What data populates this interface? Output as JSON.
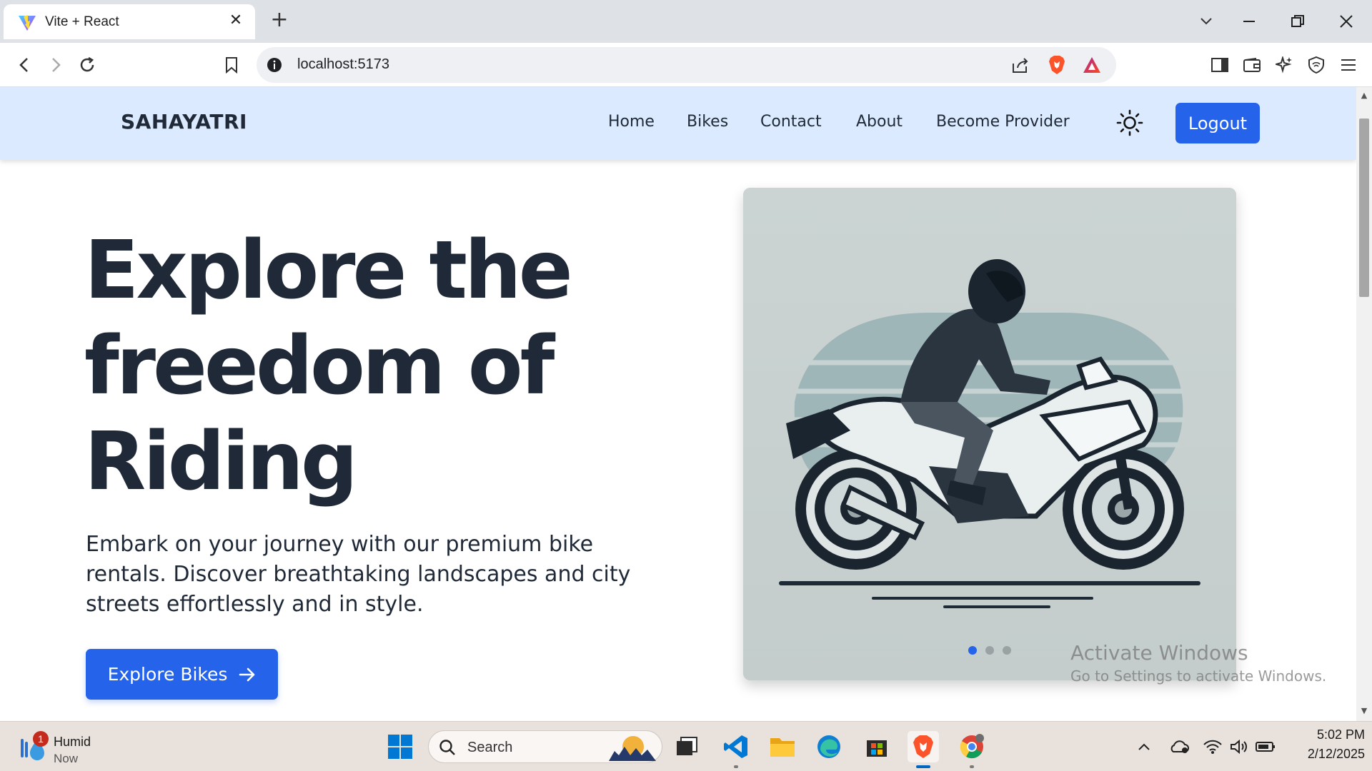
{
  "browser": {
    "tab_title": "Vite + React",
    "url": "localhost:5173"
  },
  "navbar": {
    "brand": "SAHAYATRI",
    "links": [
      "Home",
      "Bikes",
      "Contact",
      "About",
      "Become Provider"
    ],
    "logout_label": "Logout"
  },
  "hero": {
    "title_line1": "Explore the",
    "title_line2": "freedom of",
    "title_line3": "Riding",
    "description": "Embark on your journey with our premium bike rentals. Discover breathtaking landscapes and city streets effortlessly and in style.",
    "cta_label": "Explore Bikes"
  },
  "carousel": {
    "slide_count": 3,
    "active_slide": 1
  },
  "watermark": {
    "line1": "Activate Windows",
    "line2": "Go to Settings to activate Windows."
  },
  "taskbar": {
    "weather_title": "Humid",
    "weather_sub": "Now",
    "weather_badge": "1",
    "search_placeholder": "Search",
    "time": "5:02 PM",
    "date": "2/12/2025"
  },
  "colors": {
    "accent": "#2563eb",
    "navbar_bg": "#dbeafe",
    "heading": "#1f2937"
  }
}
